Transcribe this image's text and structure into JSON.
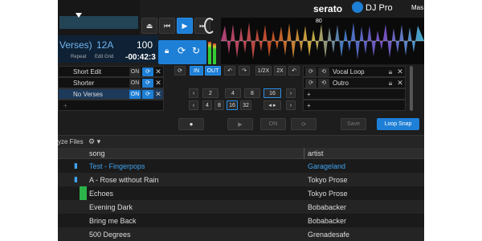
{
  "brand": {
    "serato": "serato",
    "product": "DJ Pro",
    "window_right": "Mas"
  },
  "deck": {
    "track_part": "Verses)",
    "key": "12A",
    "bpm": "100",
    "repeat_label": "Repeat",
    "edit_grid_label": "Edit Grid",
    "time_remaining": "-00:42:3",
    "beat_marker": "80"
  },
  "cues": [
    {
      "label": "Short Edit",
      "on": "ON",
      "selected": false
    },
    {
      "label": "Shorter",
      "on": "ON",
      "selected": false
    },
    {
      "label": "No Verses",
      "on": "ON",
      "selected": true
    }
  ],
  "loop_controls": {
    "in": "IN",
    "out": "OUT",
    "half": "1/2X",
    "double": "2X",
    "sizes_row1": [
      "2",
      "4",
      "8",
      "16"
    ],
    "sizes_row2": [
      "4",
      "8",
      "16",
      "32"
    ],
    "active_size_row1": "16",
    "active_size_row2": "16"
  },
  "saved_loops": [
    {
      "label": "Vocal Loop"
    },
    {
      "label": "Outro"
    }
  ],
  "record_bar": {
    "on_label": "ON",
    "save_label": "Save",
    "loop_snap_label": "Loop Snap"
  },
  "library": {
    "analyze_label": "yze Files",
    "columns": {
      "song": "song",
      "artist": "artist"
    },
    "rows": [
      {
        "song": "Test - Fingerpops",
        "artist": "Garageland",
        "highlight": true
      },
      {
        "song": "A - Rose without Rain",
        "artist": "Tokyo Prose",
        "highlight": false
      },
      {
        "song": "Echoes",
        "artist": "Tokyo Prose",
        "highlight": false
      },
      {
        "song": "Evening Dark",
        "artist": "Bobabacker",
        "highlight": false
      },
      {
        "song": "Bring me Back",
        "artist": "Bobabacker",
        "highlight": false
      },
      {
        "song": "500 Degrees",
        "artist": "Grenadesafe",
        "highlight": false
      }
    ]
  },
  "colors": {
    "accent": "#1e7fd6",
    "highlight_text": "#3fa3f0",
    "green_tag": "#2bb34a"
  }
}
